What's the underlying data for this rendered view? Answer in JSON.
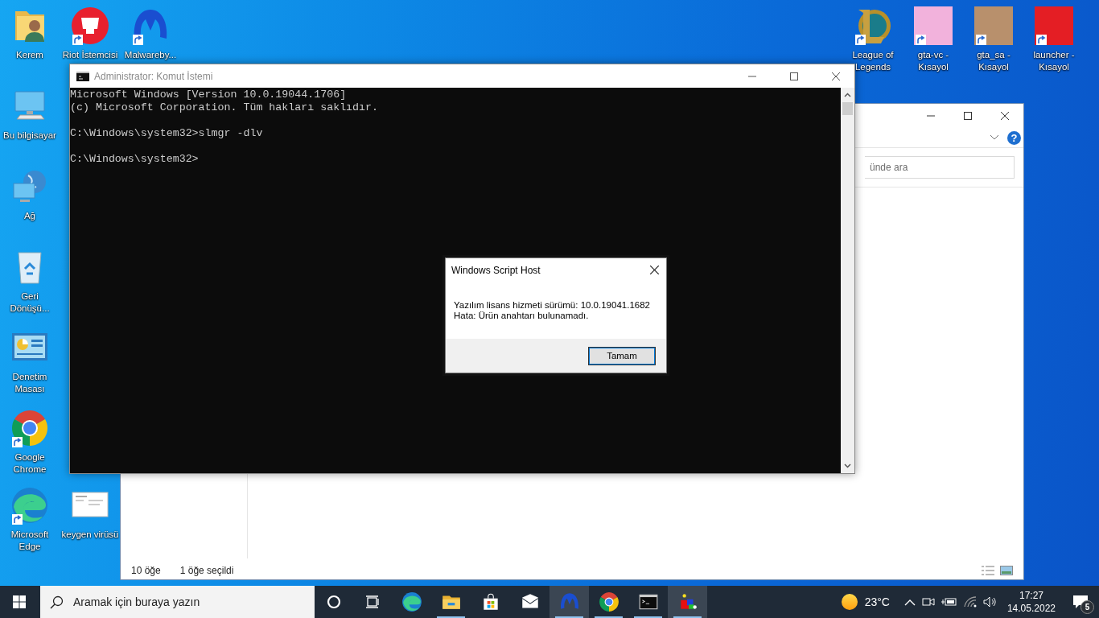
{
  "desktop_icons": [
    {
      "kind": "user-folder",
      "label": "Kerem",
      "shortcut": false
    },
    {
      "kind": "riot",
      "label": "Riot İstemcisi",
      "shortcut": true
    },
    {
      "kind": "malwarebytes",
      "label": "Malwareby...",
      "shortcut": true
    },
    {
      "kind": "league",
      "label": "League of Legends",
      "shortcut": true
    },
    {
      "kind": "game-art",
      "label": "gta-vc - Kısayol",
      "shortcut": true,
      "color": "#f2b2dc"
    },
    {
      "kind": "game-art",
      "label": "gta_sa - Kısayol",
      "shortcut": true,
      "color": "#b8906c"
    },
    {
      "kind": "game-art",
      "label": "launcher - Kısayol",
      "shortcut": true,
      "color": "#e41e24"
    },
    {
      "kind": "computer",
      "label": "Bu bilgisayar",
      "shortcut": false
    },
    {
      "kind": "network",
      "label": "Ağ",
      "shortcut": false
    },
    {
      "kind": "recycle-bin",
      "label": "Geri Dönüşü...",
      "shortcut": false
    },
    {
      "kind": "control-panel",
      "label": "Denetim Masası",
      "shortcut": false
    },
    {
      "kind": "chrome",
      "label": "Google Chrome",
      "shortcut": true
    },
    {
      "kind": "edge",
      "label": "Microsoft Edge",
      "shortcut": true
    },
    {
      "kind": "document",
      "label": "keygen virüsü",
      "shortcut": false
    }
  ],
  "explorer": {
    "search_placeholder": "ünde ara",
    "help": "?",
    "status_count": "10 öğe",
    "status_selection": "1 öğe seçildi"
  },
  "console": {
    "title": "Administrator: Komut İstemi",
    "blocks": [
      [
        "Microsoft Windows [Version 10.0.19044.1706]",
        "(c) Microsoft Corporation. Tüm hakları saklıdır."
      ],
      [
        "C:\\Windows\\system32>slmgr -dlv"
      ],
      [
        "C:\\Windows\\system32>"
      ]
    ]
  },
  "dialog": {
    "title": "Windows Script Host",
    "message_lines": [
      "Yazılım lisans hizmeti sürümü: 10.0.19041.1682",
      "Hata: Ürün anahtarı bulunamadı."
    ],
    "button": "Tamam"
  },
  "taskbar": {
    "search_placeholder": "Aramak için buraya yazın",
    "apps": [
      {
        "kind": "edge",
        "running": false,
        "highlighted": false
      },
      {
        "kind": "file-explorer",
        "running": true,
        "highlighted": false
      },
      {
        "kind": "store",
        "running": false,
        "highlighted": false
      },
      {
        "kind": "mail",
        "running": false,
        "highlighted": false
      },
      {
        "kind": "malwarebytes",
        "running": true,
        "highlighted": true
      },
      {
        "kind": "chrome",
        "running": true,
        "highlighted": false
      },
      {
        "kind": "terminal",
        "running": true,
        "highlighted": false
      },
      {
        "kind": "app-cubes",
        "running": true,
        "highlighted": true
      }
    ],
    "temperature": "23°C",
    "time": "17:27",
    "date": "14.05.2022",
    "notification_count": "5"
  }
}
